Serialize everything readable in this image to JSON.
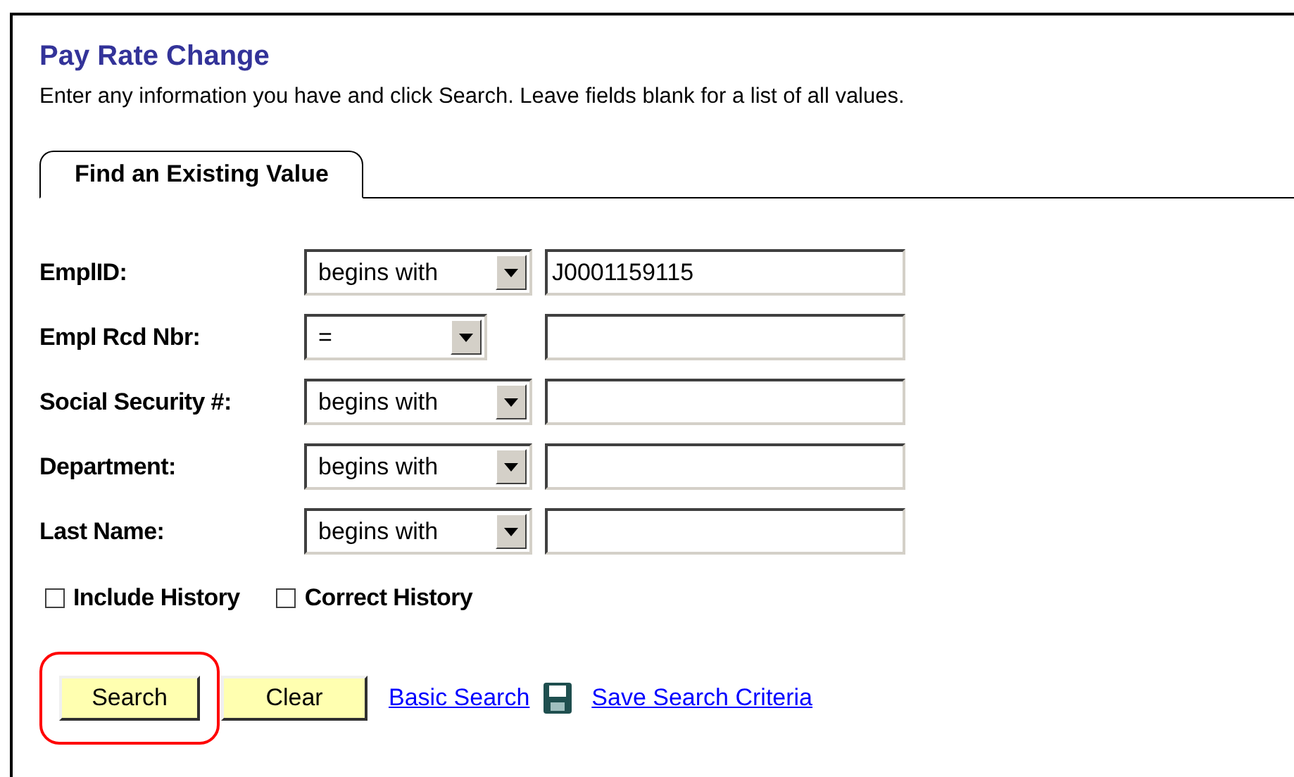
{
  "title": "Pay Rate Change",
  "instructions": "Enter any information you have and click Search. Leave fields blank for a list of all values.",
  "tabs": [
    {
      "label": "Find an Existing Value",
      "selected": true
    }
  ],
  "fields": [
    {
      "label": "EmplID:",
      "operator": "begins with",
      "value": "J0001159115",
      "narrow": false
    },
    {
      "label": "Empl Rcd Nbr:",
      "operator": "=",
      "narrow": true
    },
    {
      "label": "Social Security #:",
      "operator": "begins with",
      "narrow": false
    },
    {
      "label": "Department:",
      "operator": "begins with",
      "narrow": false
    },
    {
      "label": "Last Name:",
      "operator": "begins with",
      "narrow": false
    }
  ],
  "checkboxes": [
    {
      "label": "Include History",
      "checked": false
    },
    {
      "label": "Correct History",
      "checked": false
    }
  ],
  "buttons": [
    {
      "label": "Search",
      "highlighted": true
    },
    {
      "label": "Clear",
      "highlighted": false
    }
  ],
  "links": [
    {
      "label": "Basic Search",
      "kind": "plain"
    },
    {
      "label": "Save Search Criteria",
      "kind": "save"
    }
  ]
}
